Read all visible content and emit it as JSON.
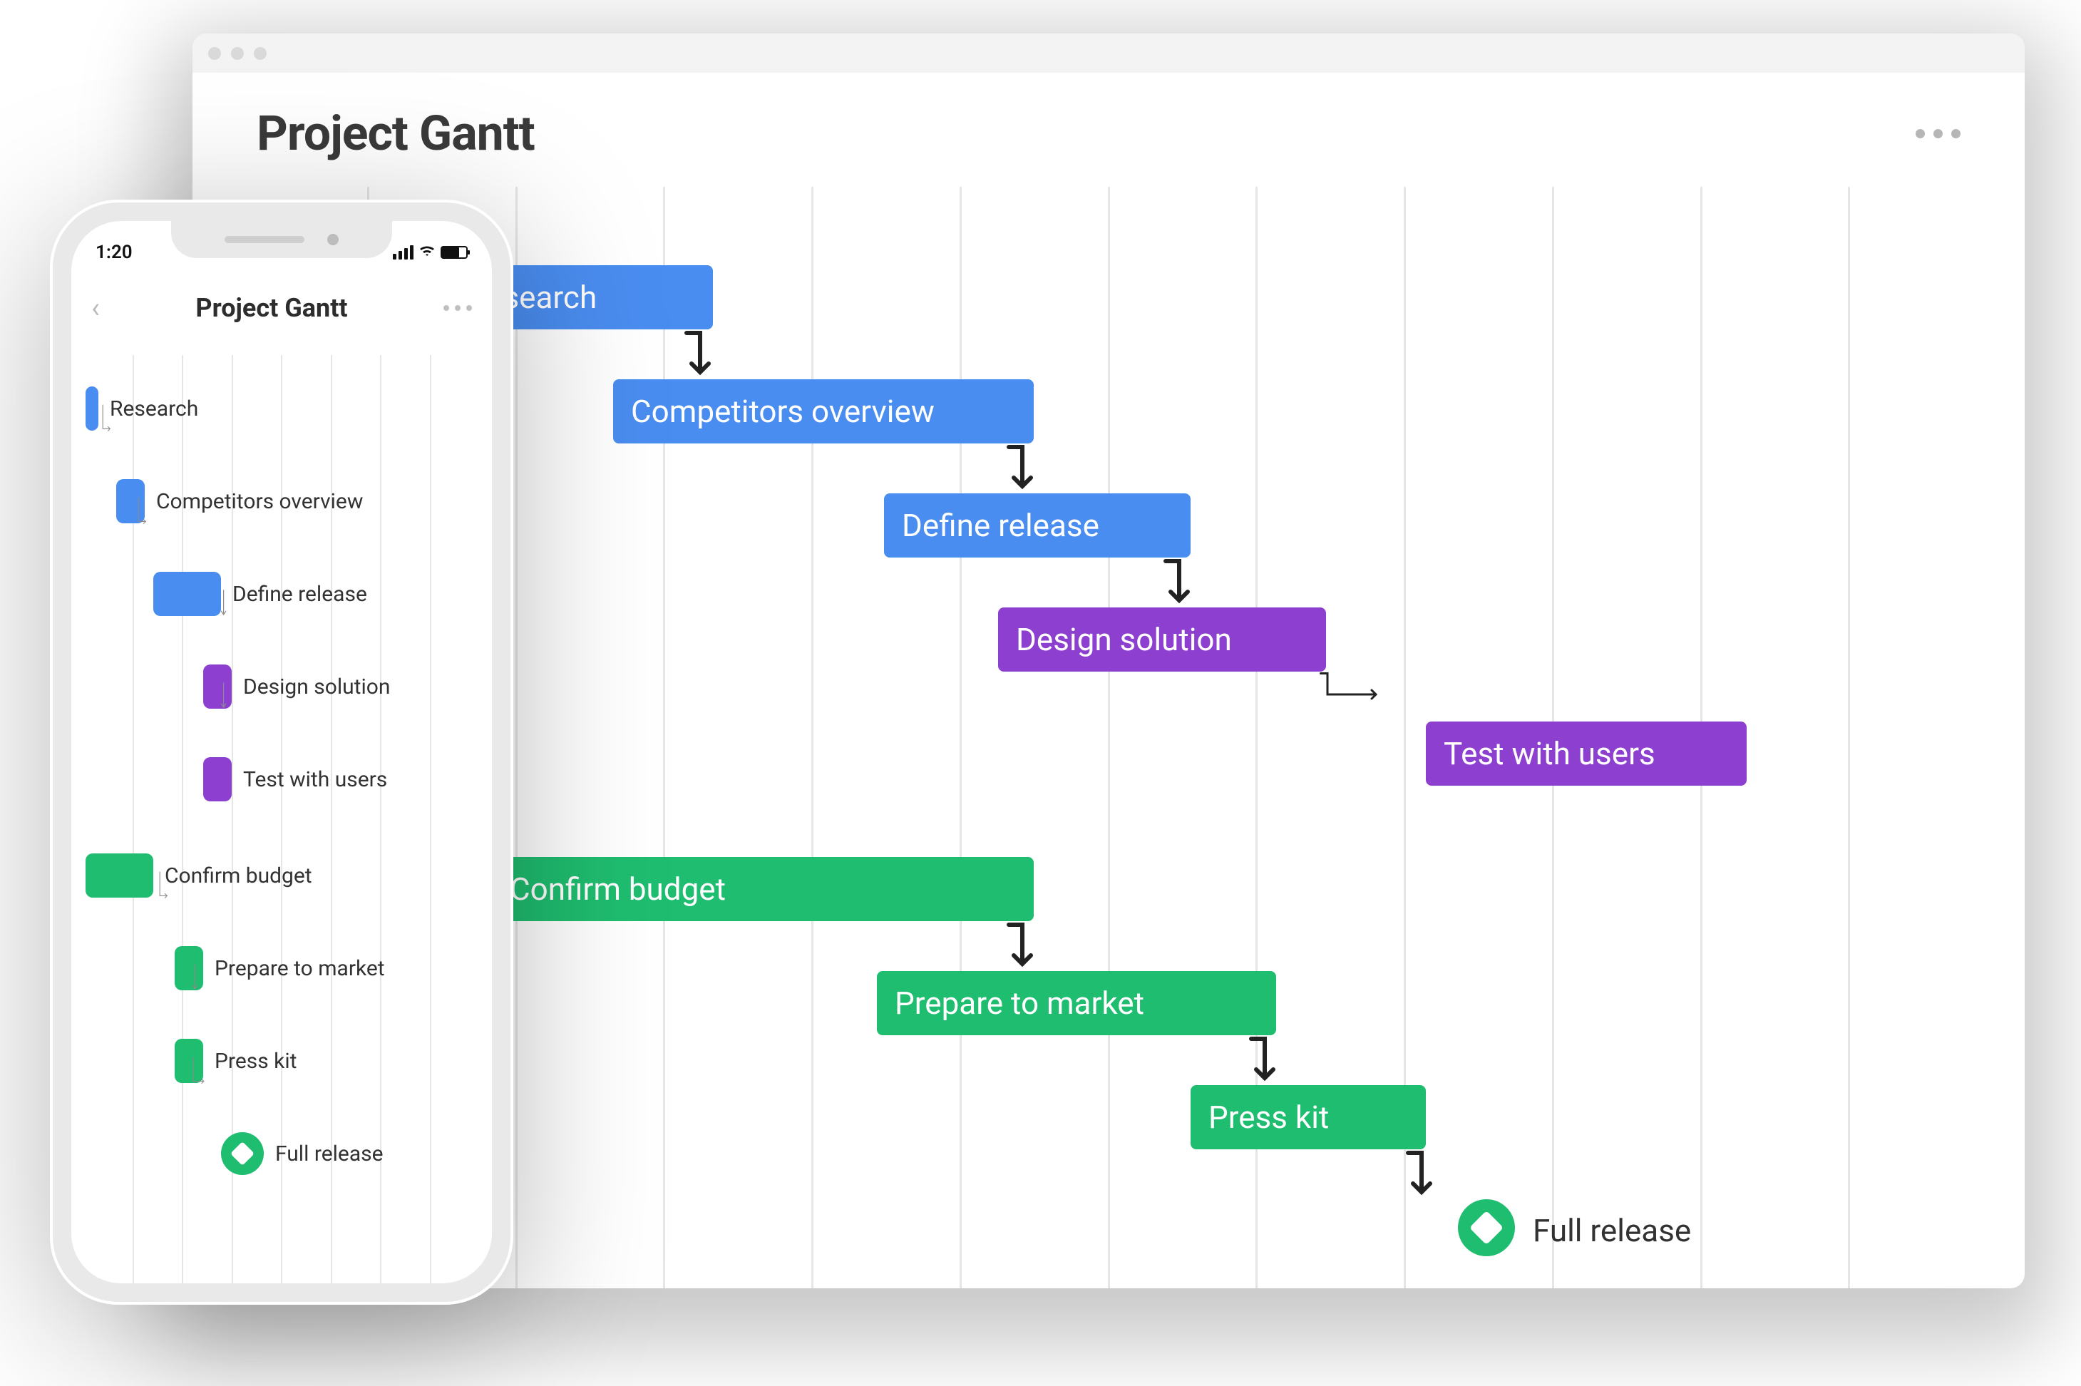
{
  "chart_data": {
    "type": "gantt",
    "title": "Project Gantt",
    "tasks": [
      {
        "id": "research",
        "label": "Research",
        "color": "blue",
        "start": 0,
        "end": 2,
        "depends_on": null
      },
      {
        "id": "competitors",
        "label": "Competitors overview",
        "color": "blue",
        "start": 2,
        "end": 6,
        "depends_on": "research"
      },
      {
        "id": "define",
        "label": "Define release",
        "color": "blue",
        "start": 5,
        "end": 8,
        "depends_on": "competitors"
      },
      {
        "id": "design",
        "label": "Design solution",
        "color": "purple",
        "start": 6,
        "end": 9,
        "depends_on": "define"
      },
      {
        "id": "test",
        "label": "Test with users",
        "color": "purple",
        "start": 9,
        "end": 12,
        "depends_on": "design"
      },
      {
        "id": "confirm",
        "label": "Confirm budget",
        "color": "green",
        "start": 1,
        "end": 6,
        "depends_on": null
      },
      {
        "id": "prepare",
        "label": "Prepare to market",
        "color": "green",
        "start": 5,
        "end": 9,
        "depends_on": "confirm"
      },
      {
        "id": "press",
        "label": "Press kit",
        "color": "green",
        "start": 8,
        "end": 10,
        "depends_on": "prepare"
      },
      {
        "id": "release",
        "label": "Full release",
        "color": "green",
        "type": "milestone",
        "start": 10,
        "depends_on": "press"
      }
    ],
    "time_units": 12
  },
  "desktop": {
    "title": "Project Gantt"
  },
  "phone": {
    "time": "1:20",
    "title": "Project Gantt"
  },
  "tasks": {
    "research": "Research",
    "competitors": "Competitors overview",
    "define": "Define release",
    "design": "Design solution",
    "test": "Test with users",
    "confirm": "Confirm budget",
    "prepare": "Prepare to market",
    "press": "Press kit",
    "release": "Full release"
  },
  "colors": {
    "blue": "#4a8df0",
    "purple": "#8d3fd0",
    "green": "#1fbd6f"
  }
}
